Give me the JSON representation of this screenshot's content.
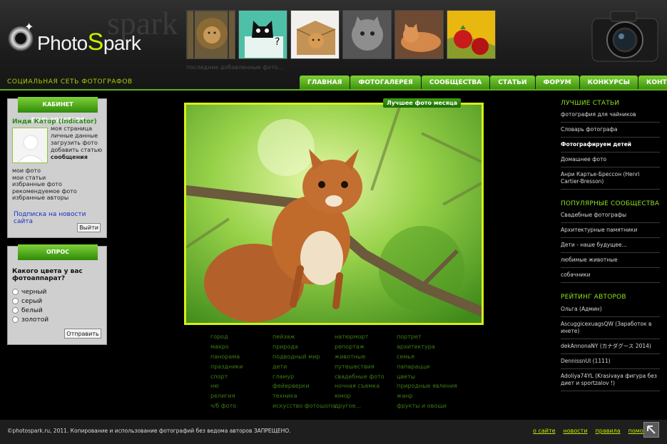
{
  "logo": {
    "ghost": "spark",
    "text_prefix": "Photo",
    "text_s": "S",
    "text_suffix": "park"
  },
  "tagline": "СОЦИАЛЬНАЯ СЕТЬ ФОТОГРАФОВ",
  "recent_caption": "последние добавленные фото...",
  "nav": [
    "ГЛАВНАЯ",
    "ФОТОГАЛЕРЕЯ",
    "СООБЩЕСТВА",
    "СТАТЬИ",
    "ФОРУМ",
    "КОНКУРСЫ",
    "КОНТАКТЫ"
  ],
  "user_panel": {
    "title": "КАБИНЕТ ПОЛЬЗОВАТЕЛЯ",
    "name": "Инди Катор (Indicator)",
    "links": [
      "моя страница",
      "личные данные",
      "загрузить фото",
      "добавить статью"
    ],
    "messages": "сообщения",
    "links2": [
      "мои фото",
      "мои статьи",
      "избранные фото",
      "рекомендуемое фото",
      "избранные авторы"
    ],
    "subscribe": "Подписка на новости сайта",
    "logout": "Выйти"
  },
  "poll": {
    "title": "ОПРОС",
    "question": "Какого цвета у вас фотоаппарат?",
    "options": [
      "черный",
      "серый",
      "белый",
      "золотой"
    ],
    "submit": "Отправить"
  },
  "photo_badge": "Лучшее фото месяца",
  "categories": [
    "город",
    "пейзаж",
    "натюрморт",
    "портрет",
    "макро",
    "природа",
    "репортаж",
    "архитектура",
    "панорама",
    "подводный мир",
    "животные",
    "семья",
    "праздники",
    "дети",
    "путешествия",
    "папарацци",
    "спорт",
    "гламур",
    "свадебные фото",
    "цветы",
    "ню",
    "фейерверки",
    "ночная съемка",
    "природные явления",
    "религия",
    "техника",
    "юмор",
    "жанр",
    "ч/б фото",
    "искусство фотошопа",
    "другое...",
    "фрукты и овощи"
  ],
  "right": {
    "articles_title": "ЛУЧШИЕ СТАТЬИ",
    "articles": [
      "фотография для чайников",
      "Словарь фотографа",
      "Фотографируем детей",
      "Домашнее фото",
      "Анри Картье-Брессон (Henri Cartier-Bresson)"
    ],
    "communities_title": "ПОПУЛЯРНЫЕ СООБЩЕСТВА",
    "communities": [
      "Свадебные фотографы",
      "Архитектурные памятники",
      "Дети - наше будущее...",
      "любимые животные",
      "собачники"
    ],
    "rating_title": "РЕЙТИНГ АВТОРОВ",
    "rating": [
      "Ольга (Админ)",
      "AscuggicexuagsQW (Заработок в инете)",
      "dekAnnonaNY (カナダグース 2014)",
      "DennissnUI (1111)",
      "Adoliya74YL (Krasivaya фигура без диет и sportzalov !)"
    ]
  },
  "footer": {
    "copyright": "©photospark.ru, 2011. Копирование и использование фотографий без ведома авторов ЗАПРЕЩЕНО.",
    "links": [
      "о сайте",
      "новости",
      "правила",
      "помощь"
    ]
  },
  "colors": {
    "accent": "#5db020",
    "link_green": "#8ee01d",
    "photo_frame": "#d5ee1a"
  }
}
